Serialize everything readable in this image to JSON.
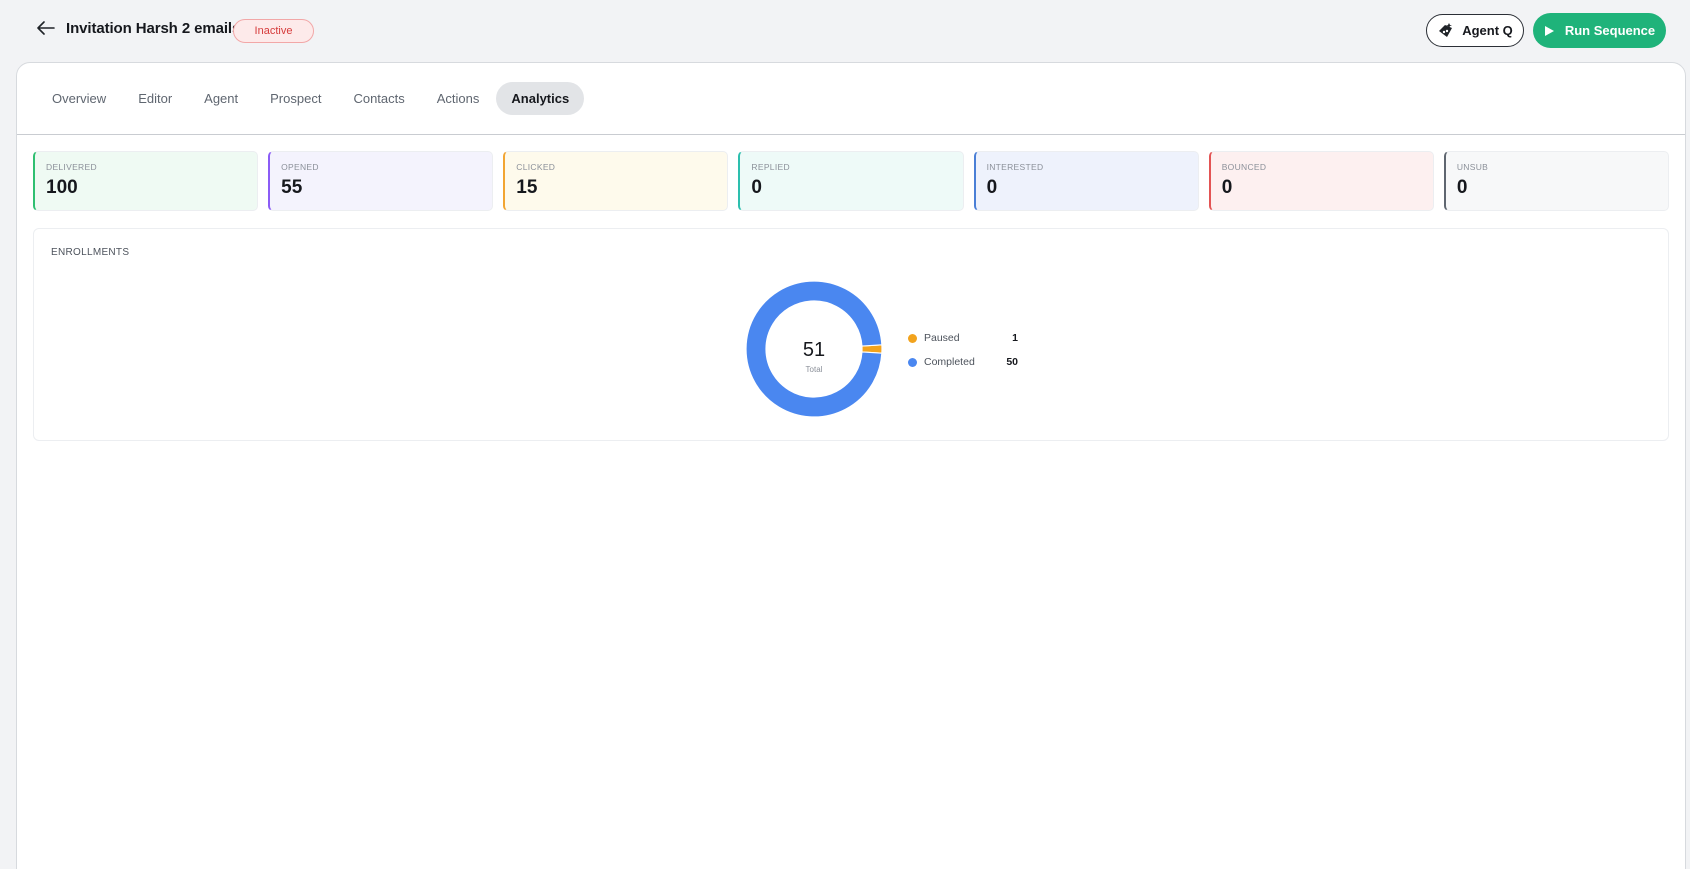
{
  "header": {
    "title": "Invitation Harsh 2 emails",
    "status": "Inactive",
    "agent_label": "Agent Q",
    "run_label": "Run Sequence"
  },
  "tabs": [
    {
      "label": "Overview",
      "active": false
    },
    {
      "label": "Editor",
      "active": false
    },
    {
      "label": "Agent",
      "active": false
    },
    {
      "label": "Prospect",
      "active": false
    },
    {
      "label": "Contacts",
      "active": false
    },
    {
      "label": "Actions",
      "active": false
    },
    {
      "label": "Analytics",
      "active": true
    }
  ],
  "metrics": [
    {
      "label": "DELIVERED",
      "value": "100",
      "accent": "#2fbf71",
      "bg": "#effaf3"
    },
    {
      "label": "OPENED",
      "value": "55",
      "accent": "#8b5cf6",
      "bg": "#f4f3fd"
    },
    {
      "label": "CLICKED",
      "value": "15",
      "accent": "#f2a533",
      "bg": "#fefaec"
    },
    {
      "label": "REPLIED",
      "value": "0",
      "accent": "#2dbfae",
      "bg": "#eefaf8"
    },
    {
      "label": "INTERESTED",
      "value": "0",
      "accent": "#4a7fd6",
      "bg": "#eef2fc"
    },
    {
      "label": "BOUNCED",
      "value": "0",
      "accent": "#e35454",
      "bg": "#fdf0f0"
    },
    {
      "label": "UNSUB",
      "value": "0",
      "accent": "#5f6670",
      "bg": "#f7f8f9"
    }
  ],
  "enrollments": {
    "title": "ENROLLMENTS",
    "total": "51",
    "total_caption": "Total"
  },
  "chart_data": {
    "type": "pie",
    "categories": [
      "Paused",
      "Completed"
    ],
    "values": [
      1,
      50
    ],
    "colors": [
      "#f2a31d",
      "#4a87f0"
    ],
    "legend": "right"
  }
}
